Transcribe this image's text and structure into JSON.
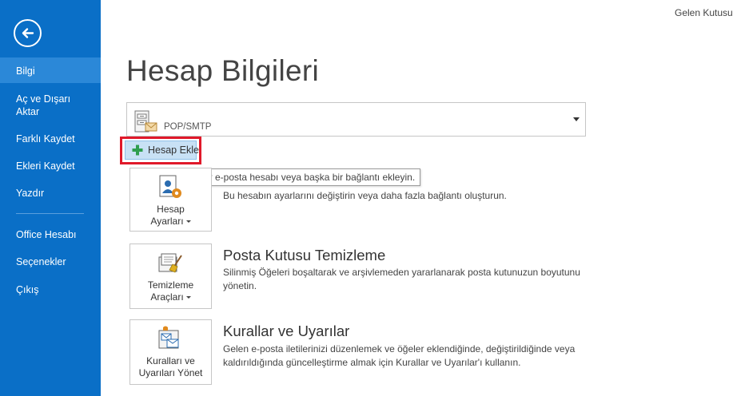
{
  "top_right": {
    "text": "Gelen Kutusu -"
  },
  "sidebar": {
    "items": [
      {
        "label": "Bilgi"
      },
      {
        "label": "Aç ve Dışarı Aktar"
      },
      {
        "label": "Farklı Kaydet"
      },
      {
        "label": "Ekleri Kaydet"
      },
      {
        "label": "Yazdır"
      },
      {
        "label": "Office Hesabı"
      },
      {
        "label": "Seçenekler"
      },
      {
        "label": "Çıkış"
      }
    ]
  },
  "page": {
    "title": "Hesap Bilgileri"
  },
  "account": {
    "type": "POP/SMTP"
  },
  "add_account": {
    "label": "Hesap Ekle",
    "tooltip": "Bir e-posta hesabı veya başka bir bağlantı ekleyin."
  },
  "sections": [
    {
      "button_line1": "Hesap",
      "button_line2": "Ayarları",
      "title": "",
      "description": "Bu hesabın ayarlarını değiştirin veya daha fazla bağlantı oluşturun."
    },
    {
      "button_line1": "Temizleme",
      "button_line2": "Araçları",
      "title": "Posta Kutusu Temizleme",
      "description": "Silinmiş Öğeleri boşaltarak ve arşivlemeden yararlanarak posta kutunuzun boyutunu yönetin."
    },
    {
      "button_line1": "Kuralları ve",
      "button_line2": "Uyarıları Yönet",
      "title": "Kurallar ve Uyarılar",
      "description": "Gelen e-posta iletilerinizi düzenlemek ve öğeler eklendiğinde, değiştirildiğinde veya kaldırıldığında güncelleştirme almak için Kurallar ve Uyarılar'ı kullanın."
    }
  ],
  "icons": {
    "back": "back-arrow-icon",
    "account": "mail-server-icon",
    "add": "plus-icon",
    "account_settings": "account-settings-icon",
    "cleanup": "cleanup-tools-icon",
    "rules": "rules-alerts-icon"
  },
  "colors": {
    "sidebar": "#0a6fc7",
    "sidebar_active": "#2b88d8",
    "highlight": "#e0192a",
    "add_button": "#c8e1f5"
  }
}
